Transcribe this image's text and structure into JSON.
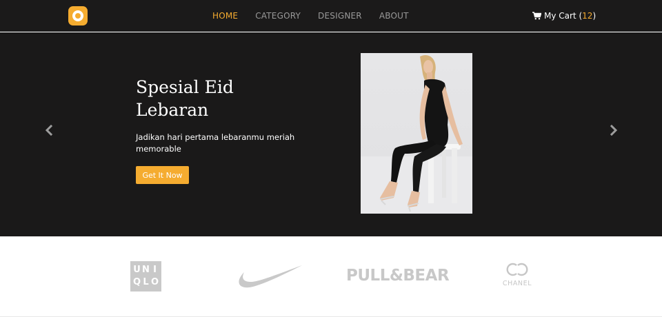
{
  "nav": {
    "links": [
      {
        "label": "HOME",
        "active": true
      },
      {
        "label": "CATEGORY",
        "active": false
      },
      {
        "label": "DESIGNER",
        "active": false
      },
      {
        "label": "ABOUT",
        "active": false
      }
    ],
    "cart": {
      "label": "My Cart",
      "open_paren": "(",
      "count": "12",
      "close_paren": ")",
      "icon": "shopping-cart-icon"
    }
  },
  "hero": {
    "title": "Spesial Eid Lebaran",
    "subtitle": "Jadikan hari pertama lebaranmu meriah memorable",
    "cta_label": "Get It Now",
    "prev_icon": "chevron-left-icon",
    "next_icon": "chevron-right-icon"
  },
  "brands": {
    "uniqlo": [
      "U",
      "N",
      "I",
      "Q",
      "L",
      "O"
    ],
    "nike": "nike-swoosh-logo",
    "pullbear": "PULL&BEAR",
    "chanel": "CHANEL"
  },
  "colors": {
    "accent": "#f5ac30",
    "navbar_bg": "#1b1a1a",
    "hero_bg": "#1a1919",
    "logo_gray": "#c8c8c8"
  }
}
